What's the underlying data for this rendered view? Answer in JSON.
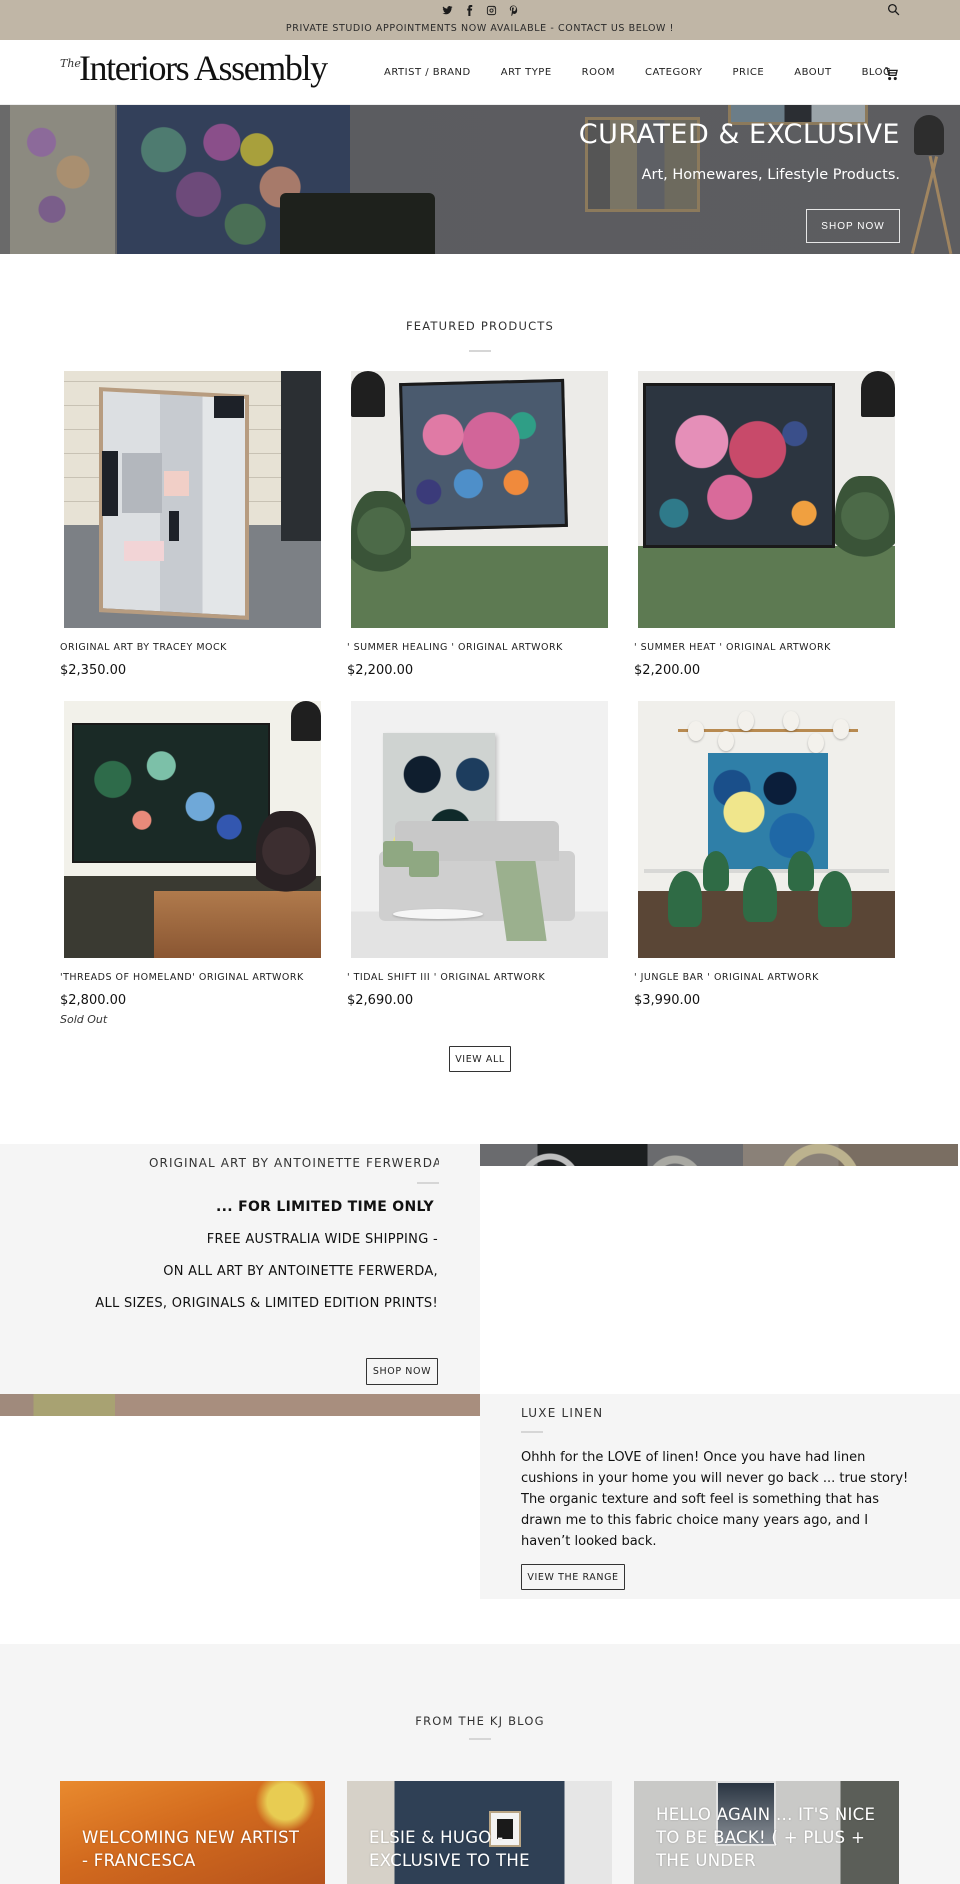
{
  "announcement": {
    "social": [
      "twitter-icon",
      "facebook-icon",
      "instagram-icon",
      "pinterest-icon"
    ],
    "text": "PRIVATE STUDIO APPOINTMENTS NOW AVAILABLE - CONTACT US BELOW !",
    "bg_color": "#c0b6a6"
  },
  "header": {
    "logo_prefix": "The",
    "logo_text": "Interiors Assembly",
    "nav": [
      "ARTIST / BRAND",
      "ART TYPE",
      "ROOM",
      "CATEGORY",
      "PRICE",
      "ABOUT",
      "BLOG"
    ]
  },
  "hero": {
    "title": "CURATED & EXCLUSIVE",
    "subtitle": "Art, Homewares, Lifestyle Products.",
    "button": "SHOP NOW"
  },
  "featured": {
    "title": "FEATURED PRODUCTS",
    "products": [
      {
        "name": "ORIGINAL ART BY TRACEY MOCK",
        "price": "$2,350.00",
        "status": ""
      },
      {
        "name": "' SUMMER HEALING ' ORIGINAL ARTWORK",
        "price": "$2,200.00",
        "status": ""
      },
      {
        "name": "' SUMMER HEAT ' ORIGINAL ARTWORK",
        "price": "$2,200.00",
        "status": ""
      },
      {
        "name": "'THREADS OF HOMELAND' ORIGINAL ARTWORK",
        "price": "$2,800.00",
        "status": "Sold Out"
      },
      {
        "name": "' TIDAL SHIFT III ' ORIGINAL ARTWORK",
        "price": "$2,690.00",
        "status": ""
      },
      {
        "name": "' JUNGLE BAR ' ORIGINAL ARTWORK",
        "price": "$3,990.00",
        "status": ""
      }
    ],
    "view_all": "VIEW ALL"
  },
  "promo": {
    "eyebrow": "ORIGINAL ART BY ANTOINETTE FERWERDA",
    "lines": [
      "... FOR LIMITED TIME ONLY",
      "FREE AUSTRALIA WIDE  SHIPPING -",
      "ON ALL ART BY ANTOINETTE FERWERDA,",
      "ALL SIZES, ORIGINALS & LIMITED EDITION PRINTS!"
    ],
    "button": "SHOP NOW"
  },
  "linen": {
    "eyebrow": "LUXE LINEN",
    "body": "Ohhh for the LOVE of linen! Once you have had linen cushions in your home you will never go back ... true story!  The organic texture and soft feel is something that has drawn me to this fabric choice many years ago, and I haven’t looked back.",
    "button": "VIEW THE RANGE"
  },
  "blog": {
    "title": "FROM THE KJ BLOG",
    "posts": [
      {
        "title": "WELCOMING NEW ARTIST - FRANCESCA"
      },
      {
        "title": "ELSIE & HUGO - EXCLUSIVE TO THE"
      },
      {
        "title": "HELLO AGAIN ... IT'S NICE TO BE BACK! ( + PLUS + THE UNDER"
      }
    ]
  }
}
